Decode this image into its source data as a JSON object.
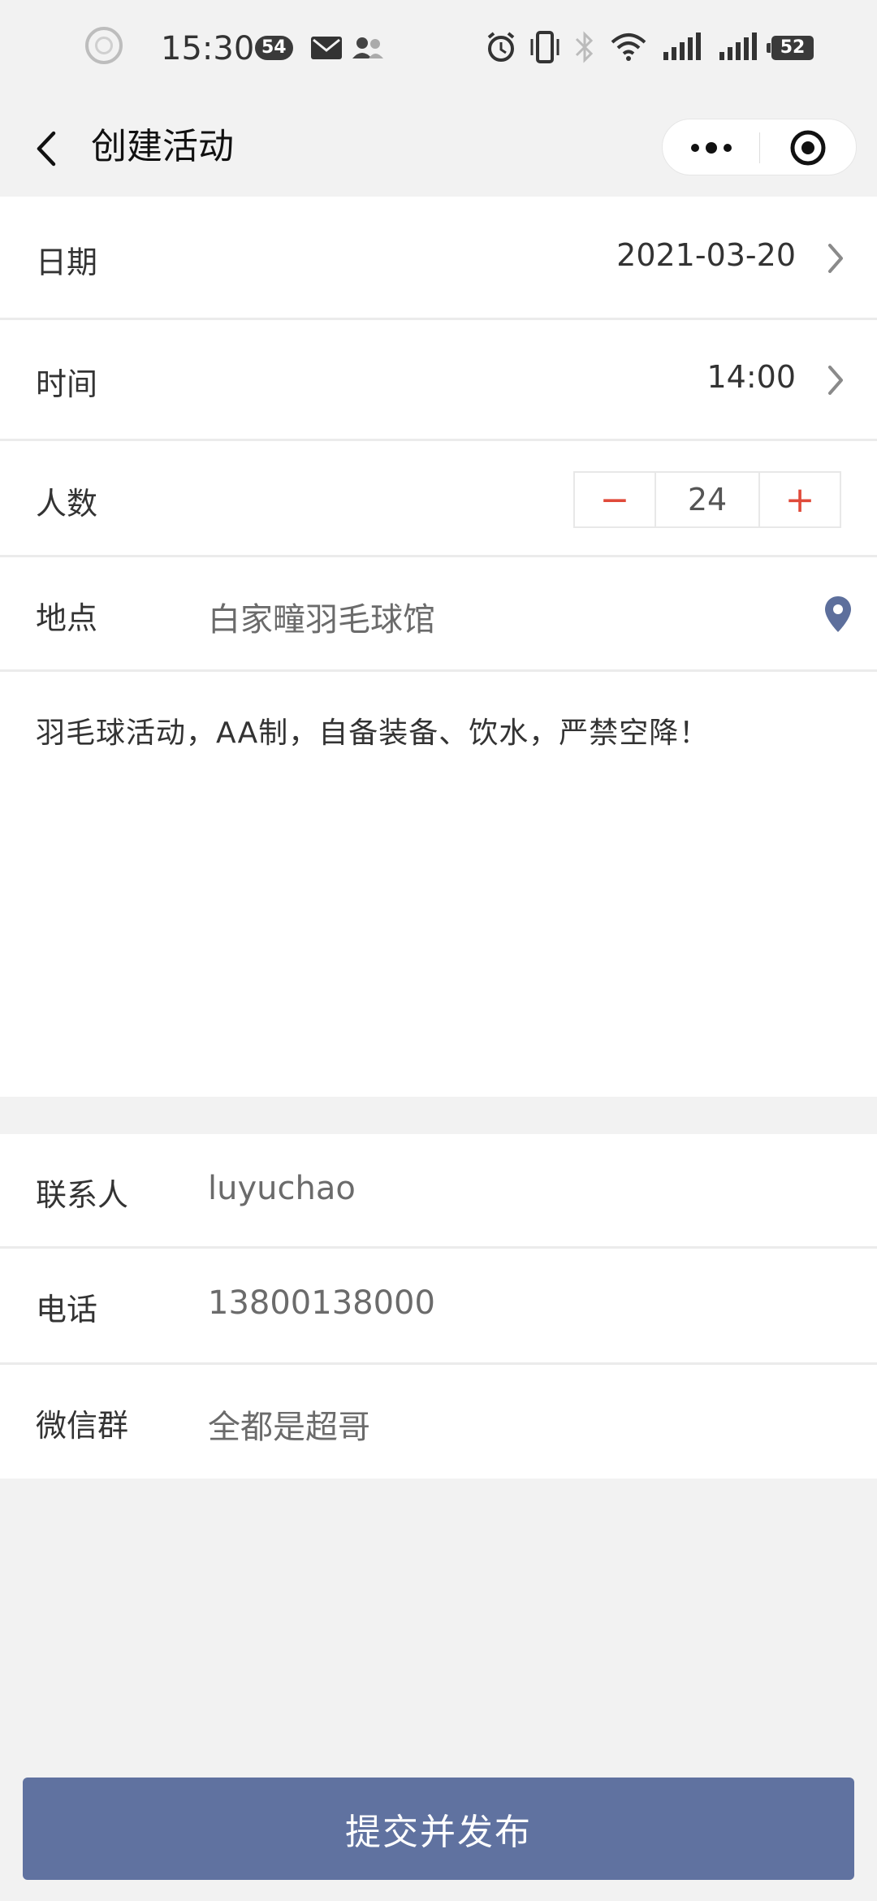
{
  "status_bar": {
    "time": "15:30",
    "notification_count": "54",
    "battery": "52",
    "icons": [
      "record-circle-icon",
      "mail-icon",
      "contacts-icon",
      "alarm-icon",
      "vibrate-icon",
      "bluetooth-icon",
      "wifi-icon",
      "signal-icon",
      "signal2-icon",
      "battery-icon"
    ]
  },
  "nav": {
    "title": "创建活动",
    "back_icon": "chevron-left-icon",
    "more_icon": "more-dots-icon",
    "close_icon": "target-circle-icon"
  },
  "form": {
    "date": {
      "label": "日期",
      "value": "2021-03-20"
    },
    "time": {
      "label": "时间",
      "value": "14:00"
    },
    "people": {
      "label": "人数",
      "value": "24",
      "minus": "−",
      "plus": "+"
    },
    "location": {
      "label": "地点",
      "value": "白家疃羽毛球馆",
      "icon": "location-pin-icon"
    },
    "description": "羽毛球活动，AA制，自备装备、饮水，严禁空降！",
    "contact": {
      "label": "联系人",
      "value": "luyuchao"
    },
    "phone": {
      "label": "电话",
      "value": "13800138000"
    },
    "wechat_group": {
      "label": "微信群",
      "value": "全都是超哥"
    }
  },
  "submit_label": "提交并发布",
  "colors": {
    "accent": "#6072a0",
    "stepper": "#e04a3a",
    "pin": "#5d6f9c",
    "background": "#f2f2f2"
  }
}
